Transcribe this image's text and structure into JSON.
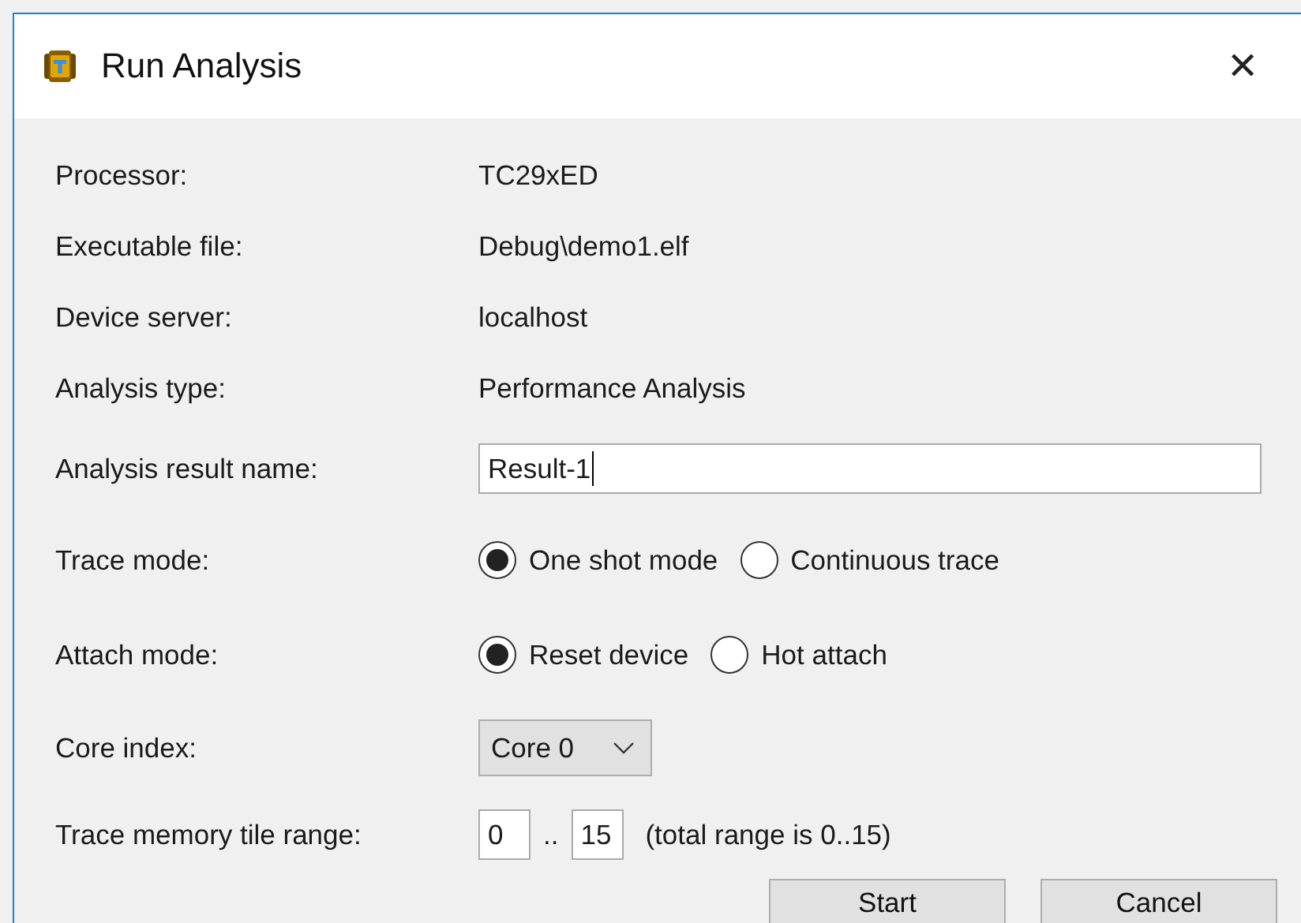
{
  "window": {
    "title": "Run Analysis",
    "close": "✕"
  },
  "rows": [
    {
      "kind": "text",
      "label": "Processor:",
      "value": "TC29xED"
    },
    {
      "kind": "text",
      "label": "Executable file:",
      "value": "Debug\\demo1.elf"
    },
    {
      "kind": "text",
      "label": "Device server:",
      "value": "localhost"
    },
    {
      "kind": "text",
      "label": "Analysis type:",
      "value": "Performance Analysis"
    },
    {
      "kind": "input",
      "label": "Analysis result name:",
      "value": "Result-1"
    },
    {
      "kind": "radio",
      "label": "Trace mode:",
      "options": [
        {
          "label": "One shot mode",
          "selected": true
        },
        {
          "label": "Continuous trace",
          "selected": false
        }
      ]
    },
    {
      "kind": "radio",
      "label": "Attach mode:",
      "options": [
        {
          "label": "Reset device",
          "selected": true
        },
        {
          "label": "Hot attach",
          "selected": false
        }
      ]
    },
    {
      "kind": "select",
      "label": "Core index:",
      "value": "Core 0"
    },
    {
      "kind": "range",
      "label": "Trace memory tile range:",
      "from": "0",
      "sep": "..",
      "to": "15",
      "note": "(total range is 0..15)"
    }
  ],
  "buttons": [
    "Start",
    "Cancel"
  ]
}
